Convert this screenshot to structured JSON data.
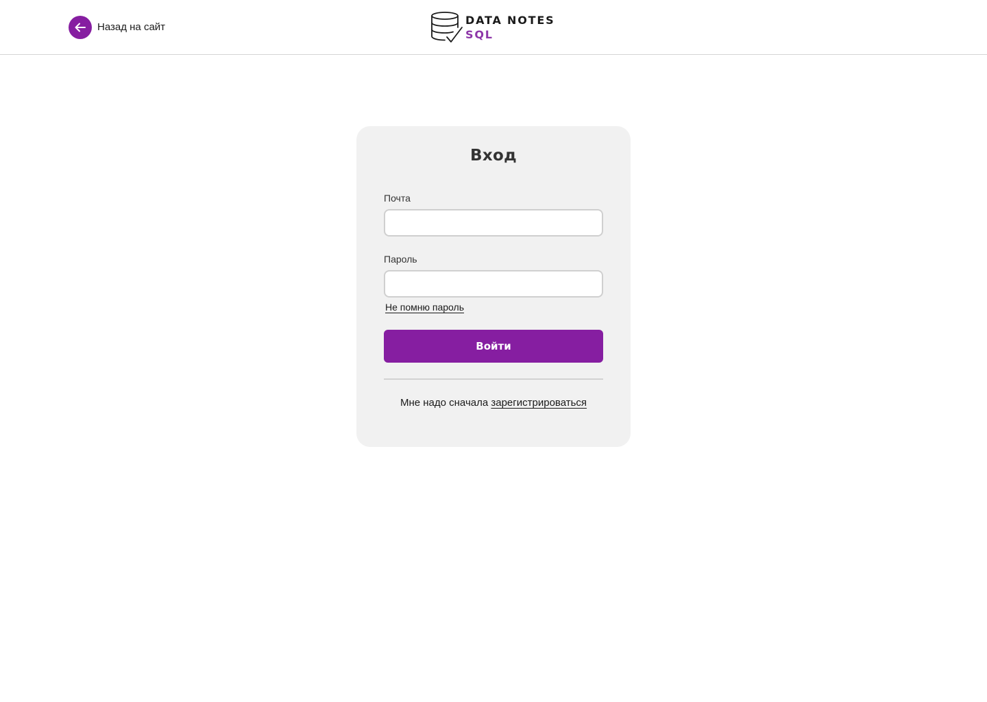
{
  "colors": {
    "accent": "#861ea1",
    "card_bg": "#f1f1f1",
    "input_border": "#cfcfcf",
    "divider": "#d2d2d2"
  },
  "header": {
    "back_label": "Назад на сайт",
    "back_icon": "arrow-left-icon",
    "logo": {
      "icon": "database-check-icon",
      "line1": "DATA NOTES",
      "line2": "SQL"
    }
  },
  "login": {
    "title": "Вход",
    "email": {
      "label": "Почта",
      "value": "",
      "placeholder": ""
    },
    "password": {
      "label": "Пароль",
      "value": "",
      "placeholder": ""
    },
    "forgot_label": "Не помню пароль",
    "submit_label": "Войти",
    "register_prefix": "Мне надо сначала",
    "register_link": "зарегистрироваться"
  }
}
